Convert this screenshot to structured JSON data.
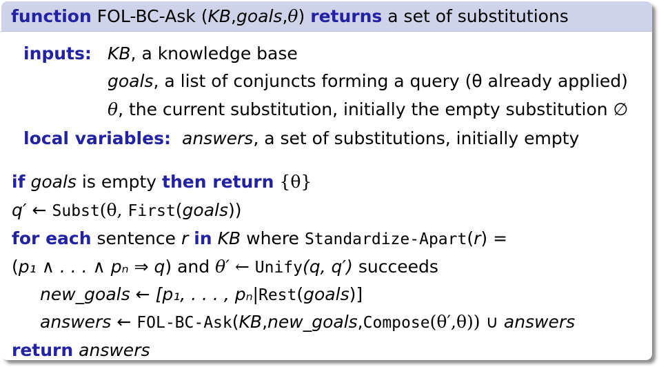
{
  "header": {
    "kw_function": "function",
    "name": "FOL-BC-Ask",
    "params_open": "(",
    "p_kb": "KB",
    "comma1": ",",
    "p_goals": "goals",
    "comma2": ",",
    "p_theta": "θ",
    "params_close": ")",
    "kw_returns": "returns",
    "rest": "a set of substitutions"
  },
  "inputs": {
    "label": "inputs:",
    "kb_var": "KB",
    "kb_desc": ", a knowledge base",
    "goals_var": "goals",
    "goals_desc": ", a list of conjuncts forming a query (θ already applied)",
    "theta_var": "θ",
    "theta_desc": ", the current substitution, initially the empty substitution ∅"
  },
  "locals": {
    "label": "local variables:",
    "answers_var": "answers",
    "answers_desc": ", a set of substitutions, initially empty"
  },
  "body": {
    "l1_if": "if",
    "l1_goals": "goals",
    "l1_is_empty": "is empty",
    "l1_then_return": "then return",
    "l1_set": "{θ}",
    "l2_q": "q′",
    "l2_arrow": "←",
    "l2_subst": "Subst",
    "l2_args_a": "(θ,",
    "l2_first": "First",
    "l2_args_b": "(",
    "l2_goals": "goals",
    "l2_args_c": "))",
    "l3_for_each": "for each",
    "l3_sentence": "sentence",
    "l3_r": "r",
    "l3_in": "in",
    "l3_kb": "KB",
    "l3_where": "where",
    "l3_std": "Standardize-Apart",
    "l3_open": "(",
    "l3_r2": "r",
    "l3_close": ") =",
    "l4_open": "(",
    "l4_formula": "p₁ ∧ . . . ∧ pₙ ⇒ q",
    "l4_close": ")",
    "l4_and": "and",
    "l4_thetap": "θ′ ←",
    "l4_unify": "Unify",
    "l4_args": "(q, q′)",
    "l4_succeeds": "succeeds",
    "l5_newgoals": "new_goals",
    "l5_arrow": "←",
    "l5_list": "[p₁, . . . , pₙ|",
    "l5_rest": "Rest",
    "l5_open": "(",
    "l5_goals": "goals",
    "l5_close": ")]",
    "l6_answers": "answers",
    "l6_arrow": "←",
    "l6_fol": "FOL-BC-Ask",
    "l6_open": "(",
    "l6_kb": "KB",
    "l6_c1": ",",
    "l6_newgoals": "new_goals",
    "l6_c2": ",",
    "l6_compose": "Compose",
    "l6_args": "(θ′,θ))",
    "l6_union": "∪",
    "l6_answers2": "answers",
    "l7_return": "return",
    "l7_answers": "answers"
  },
  "colors": {
    "keyword": "#2222a3",
    "header_bg": "#cfd3e9"
  }
}
